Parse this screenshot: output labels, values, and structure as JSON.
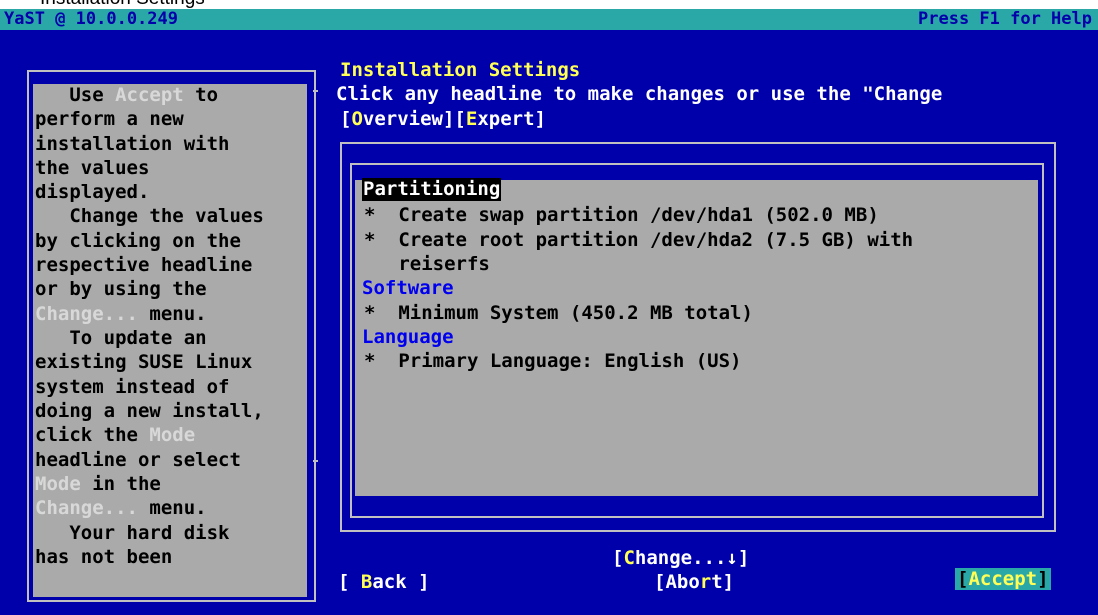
{
  "caption": "Installation Settings",
  "titlebar": {
    "left": "YaST @ 10.0.0.249",
    "right": "Press F1 for Help"
  },
  "heading": "Installation Settings",
  "instruction": "Click any headline to make changes or use the \"Change",
  "views": {
    "overview": "[Overview]",
    "expert": "[Expert]"
  },
  "help": [
    "   Use Accept to",
    "perform a new",
    "installation with",
    "the values",
    "displayed.",
    "   Change the values",
    "by clicking on the",
    "respective headline",
    "or by using the",
    "Change... menu.",
    "   To update an",
    "existing SUSE Linux",
    "system instead of",
    "doing a new install,",
    "click the Mode",
    "headline or select",
    "Mode in the",
    "Change... menu.",
    "   Your hard disk",
    "has not been"
  ],
  "overview": {
    "partitioning": {
      "heading": "Partitioning",
      "items": [
        "*  Create swap partition /dev/hda1 (502.0 MB)",
        "*  Create root partition /dev/hda2 (7.5 GB) with",
        "   reiserfs"
      ]
    },
    "software": {
      "heading": "Software",
      "items": [
        "*  Minimum System (450.2 MB total)"
      ]
    },
    "language": {
      "heading": "Language",
      "items": [
        "*  Primary Language: English (US)"
      ]
    }
  },
  "buttons": {
    "change": "[Change...↓]",
    "back": "[ Back ]",
    "abort": "[Abort]",
    "accept": "[Accept]"
  },
  "colors": {
    "screen": "#0000aa",
    "titlebar": "#2aa8a8",
    "panel": "#aaaaaa",
    "highlight": "#ffff55"
  }
}
